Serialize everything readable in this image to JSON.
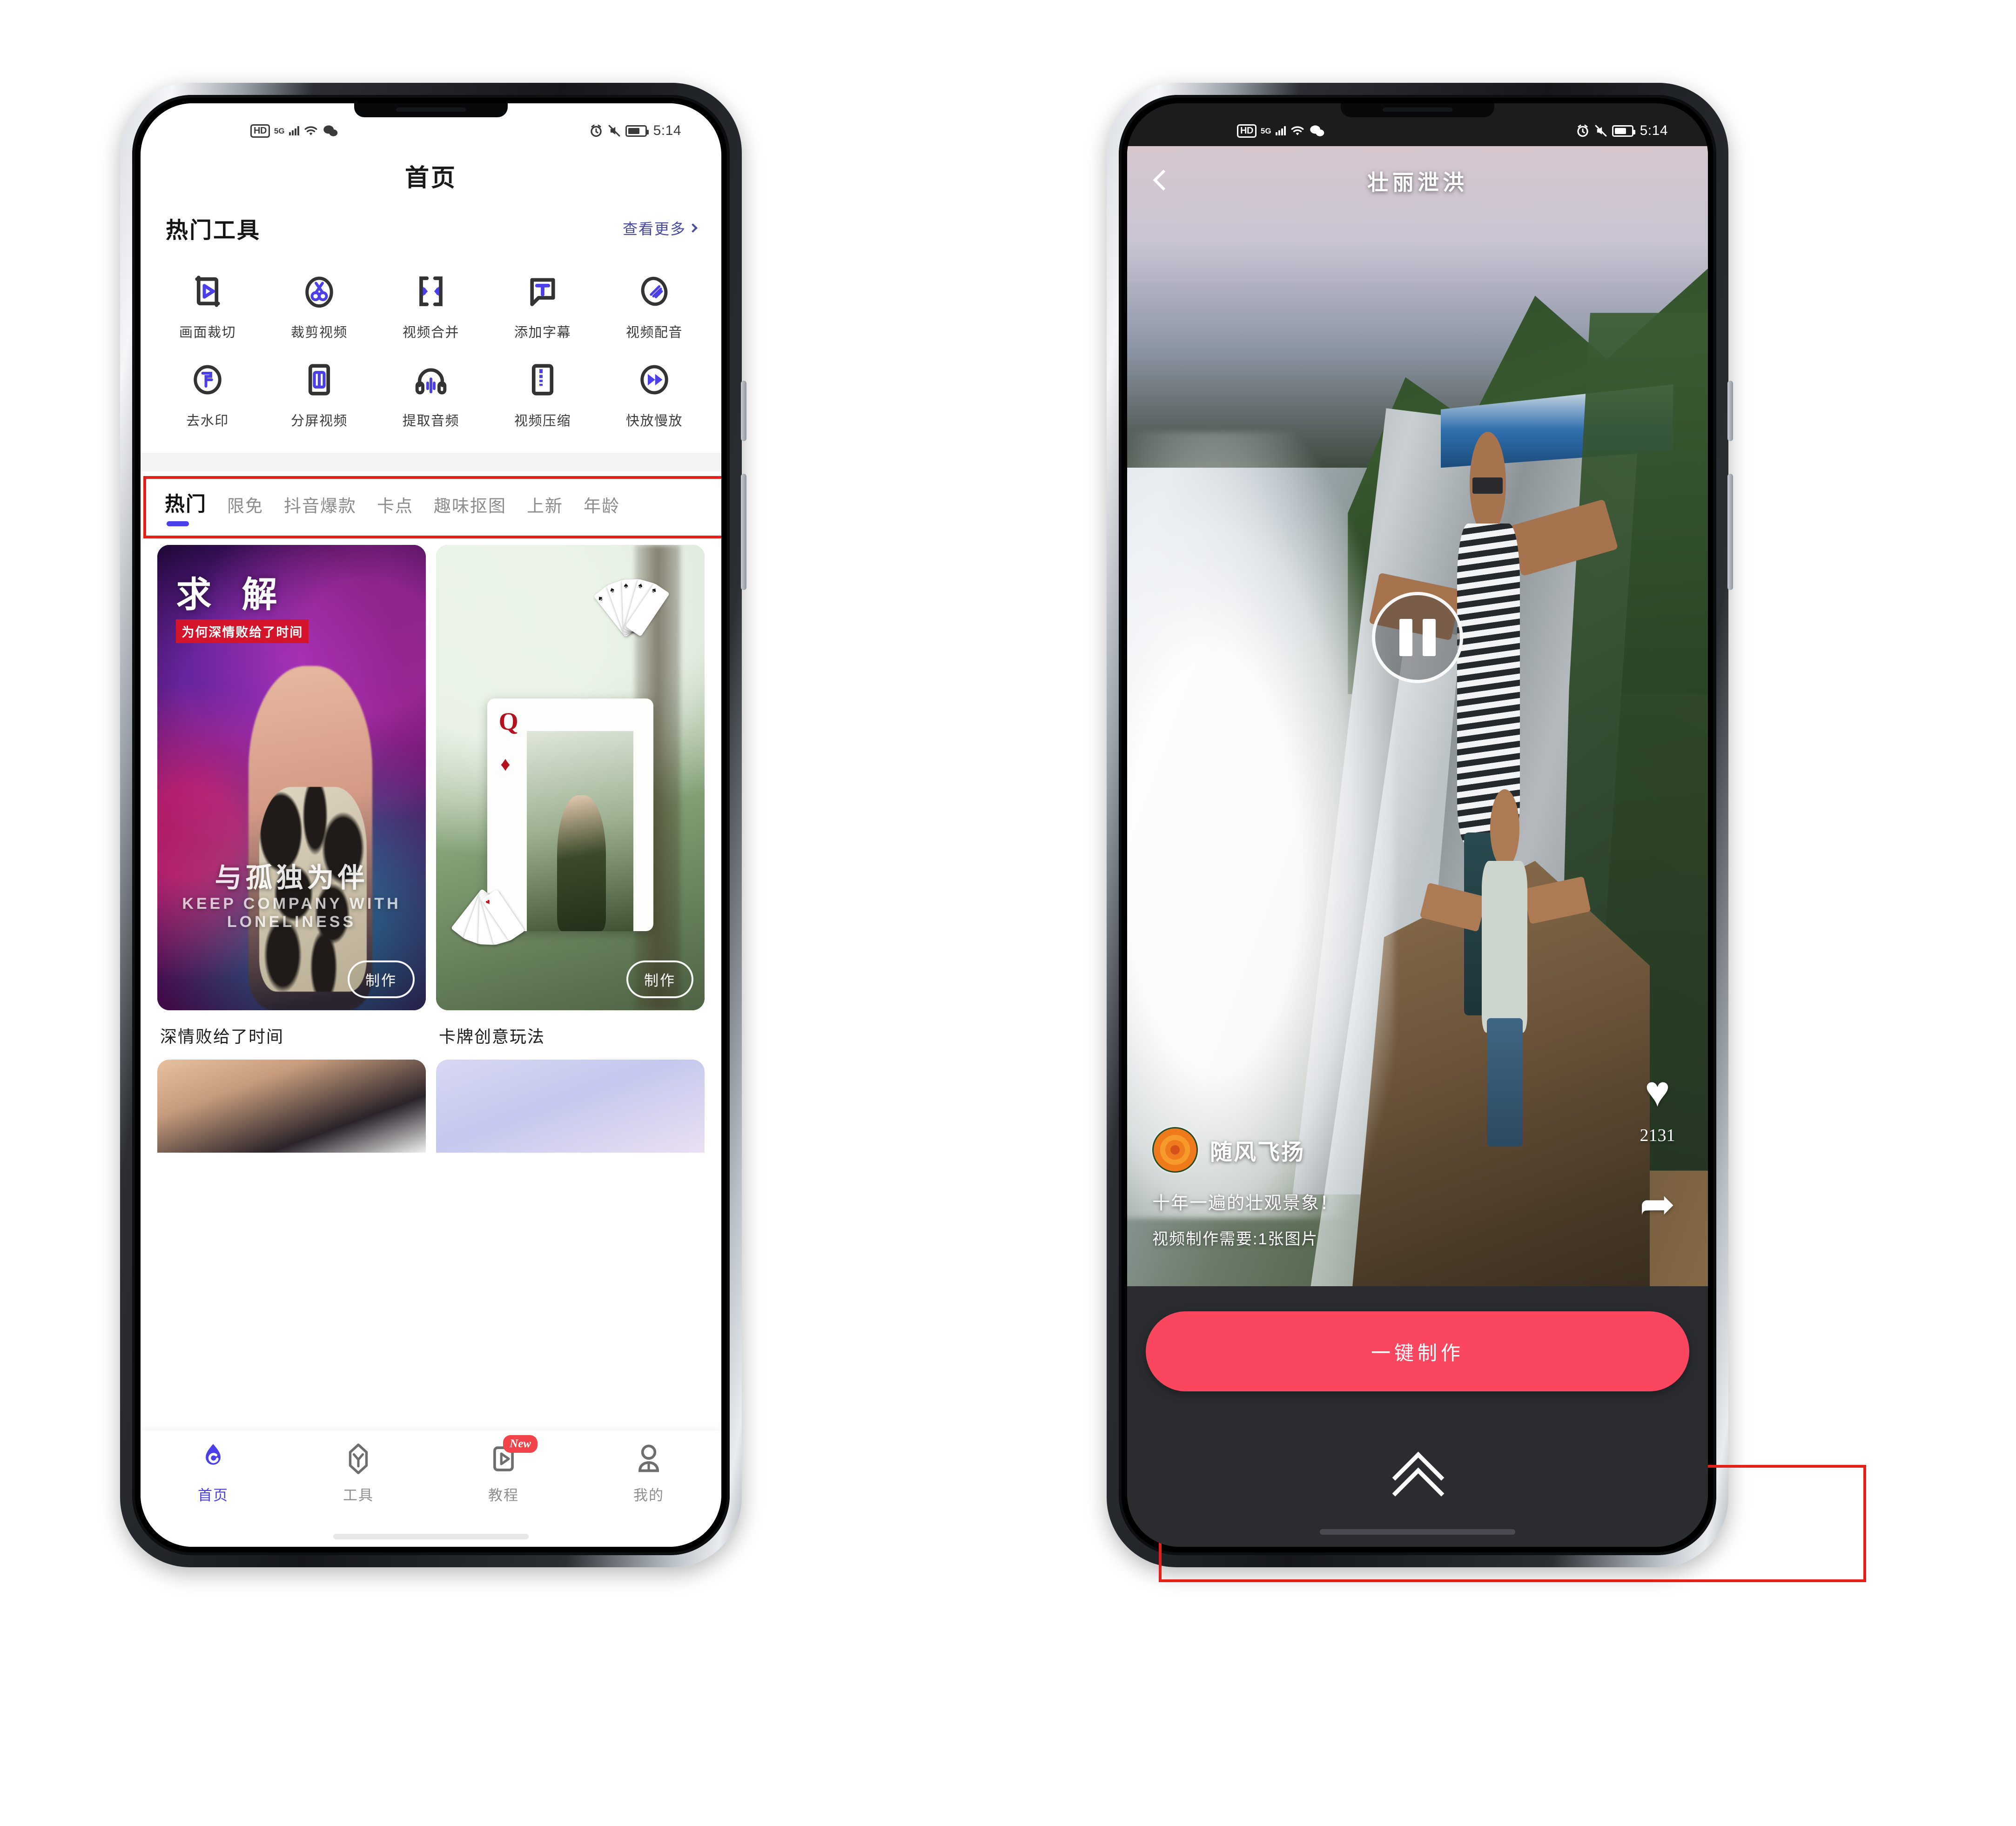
{
  "status_bar": {
    "hd": "HD",
    "network": "5G",
    "time": "5:14",
    "icons": [
      "hd-icon",
      "signal-icon",
      "wifi-icon",
      "wechat-icon",
      "alarm-icon",
      "mute-icon",
      "battery-icon"
    ]
  },
  "colors": {
    "accent_blue": "#4A3FE8",
    "link_purple": "#4A4A9E",
    "highlight_red": "#E32119",
    "cta_pink": "#FB4660",
    "badge_red": "#F3434A"
  },
  "left_screen": {
    "page_title": "首页",
    "tools_section": {
      "heading": "热门工具",
      "more_label": "查看更多",
      "more_icon": "chevron-right-icon",
      "items": [
        {
          "label": "画面裁切",
          "icon": "crop-frame-icon"
        },
        {
          "label": "裁剪视频",
          "icon": "scissors-icon"
        },
        {
          "label": "视频合并",
          "icon": "merge-arrows-icon"
        },
        {
          "label": "添加字幕",
          "icon": "subtitle-text-icon"
        },
        {
          "label": "视频配音",
          "icon": "voice-over-icon"
        },
        {
          "label": "去水印",
          "icon": "remove-watermark-icon"
        },
        {
          "label": "分屏视频",
          "icon": "split-screen-icon"
        },
        {
          "label": "提取音频",
          "icon": "headphones-icon"
        },
        {
          "label": "视频压缩",
          "icon": "compress-icon"
        },
        {
          "label": "快放慢放",
          "icon": "fast-forward-icon"
        }
      ]
    },
    "tabs": [
      {
        "label": "热门",
        "active": true
      },
      {
        "label": "限免",
        "active": false
      },
      {
        "label": "抖音爆款",
        "active": false
      },
      {
        "label": "卡点",
        "active": false
      },
      {
        "label": "趣味抠图",
        "active": false
      },
      {
        "label": "上新",
        "active": false
      },
      {
        "label": "年龄",
        "active": false
      }
    ],
    "cards": [
      {
        "caption": "深情败给了时间",
        "make_label": "制作",
        "overlay_title": "求 解",
        "overlay_sub": "为何深情败给了时间",
        "overlay_bottom": "与孤独为伴",
        "overlay_bottom_en": "KEEP COMPANY WITH LONELINESS"
      },
      {
        "caption": "卡牌创意玩法",
        "make_label": "制作",
        "card_rank": "Q",
        "card_suit": "♦"
      }
    ],
    "bottom_nav": [
      {
        "label": "首页",
        "icon": "home-pin-icon",
        "active": true,
        "badge": ""
      },
      {
        "label": "工具",
        "icon": "tools-diamond-icon",
        "active": false,
        "badge": ""
      },
      {
        "label": "教程",
        "icon": "tutorial-video-icon",
        "active": false,
        "badge": "New"
      },
      {
        "label": "我的",
        "icon": "person-icon",
        "active": false,
        "badge": ""
      }
    ]
  },
  "right_screen": {
    "title": "壮丽泄洪",
    "back_icon": "chevron-left-icon",
    "player": {
      "state_icon": "pause-icon"
    },
    "actions": {
      "like_icon": "heart-icon",
      "like_count": "2131",
      "share_icon": "share-arrow-icon"
    },
    "author": {
      "name": "随风飞扬",
      "avatar_icon": "flower-avatar"
    },
    "description": "十年一遍的壮观景象！",
    "requirement": "视频制作需要:1张图片",
    "cta_label": "一键制作",
    "expand_icon": "double-chevron-up-icon"
  }
}
